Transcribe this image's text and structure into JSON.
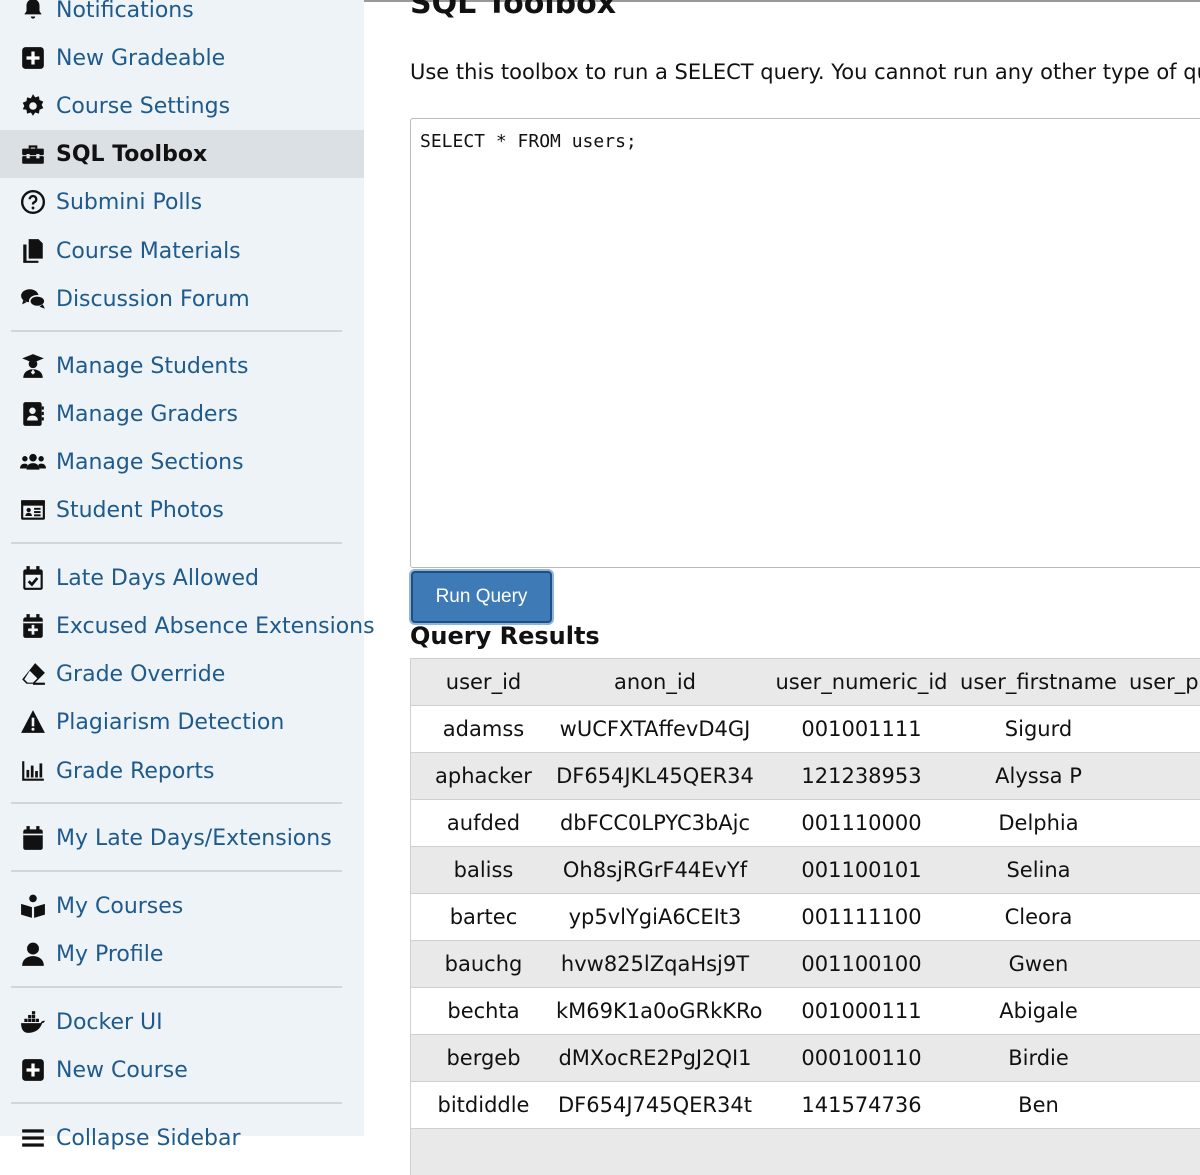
{
  "sidebar": {
    "items": [
      {
        "label": "Notifications",
        "icon": "bell-icon"
      },
      {
        "label": "New Gradeable",
        "icon": "plus-square-icon"
      },
      {
        "label": "Course Settings",
        "icon": "gear-icon"
      },
      {
        "label": "SQL Toolbox",
        "icon": "toolbox-icon",
        "active": true
      },
      {
        "label": "Submini Polls",
        "icon": "question-circle-icon"
      },
      {
        "label": "Course Materials",
        "icon": "copy-icon"
      },
      {
        "label": "Discussion Forum",
        "icon": "comments-icon"
      },
      {
        "label": "Manage Students",
        "icon": "user-graduate-icon"
      },
      {
        "label": "Manage Graders",
        "icon": "address-book-icon"
      },
      {
        "label": "Manage Sections",
        "icon": "users-icon"
      },
      {
        "label": "Student Photos",
        "icon": "id-card-icon"
      },
      {
        "label": "Late Days Allowed",
        "icon": "calendar-check-icon"
      },
      {
        "label": "Excused Absence Extensions",
        "icon": "calendar-plus-icon"
      },
      {
        "label": "Grade Override",
        "icon": "eraser-icon"
      },
      {
        "label": "Plagiarism Detection",
        "icon": "warning-icon"
      },
      {
        "label": "Grade Reports",
        "icon": "chart-bar-icon"
      },
      {
        "label": "My Late Days/Extensions",
        "icon": "calendar-icon"
      },
      {
        "label": "My Courses",
        "icon": "book-reader-icon"
      },
      {
        "label": "My Profile",
        "icon": "user-icon"
      },
      {
        "label": "Docker UI",
        "icon": "docker-icon"
      },
      {
        "label": "New Course",
        "icon": "plus-square-icon"
      },
      {
        "label": "Collapse Sidebar",
        "icon": "bars-icon"
      }
    ]
  },
  "main": {
    "title": "SQL Toolbox",
    "intro": "Use this toolbox to run a SELECT query. You cannot run any other type of query,",
    "query": "SELECT * FROM users;",
    "run_button": "Run Query",
    "results_title": "Query Results"
  },
  "table": {
    "headers": [
      "user_id",
      "anon_id",
      "user_numeric_id",
      "user_firstname",
      "user_pr"
    ],
    "rows": [
      [
        "adamss",
        "wUCFXTAffevD4GJ",
        "001001111",
        "Sigurd",
        ""
      ],
      [
        "aphacker",
        "DF654JKL45QER34",
        "121238953",
        "Alyssa P",
        ""
      ],
      [
        "aufded",
        "dbFCC0LPYC3bAjc",
        "001110000",
        "Delphia",
        ""
      ],
      [
        "baliss",
        "Oh8sjRGrF44EvYf",
        "001100101",
        "Selina",
        ""
      ],
      [
        "bartec",
        "yp5vlYgiA6CEIt3",
        "001111100",
        "Cleora",
        ""
      ],
      [
        "bauchg",
        "hvw825lZqaHsj9T",
        "001100100",
        "Gwen",
        ""
      ],
      [
        "bechta",
        "kM69K1a0oGRkKRo",
        "001000111",
        "Abigale",
        ""
      ],
      [
        "bergeb",
        "dMXocRE2PgJ2QI1",
        "000100110",
        "Birdie",
        ""
      ],
      [
        "bitdiddle",
        "DF654J745QER34t",
        "141574736",
        "Ben",
        ""
      ]
    ]
  },
  "colors": {
    "sidebar_bg": "#eef3f8",
    "link": "#1e5a8c",
    "active_bg": "#dbe0e5",
    "button": "#3d7ab6",
    "row_shade": "#e9e9e9"
  }
}
